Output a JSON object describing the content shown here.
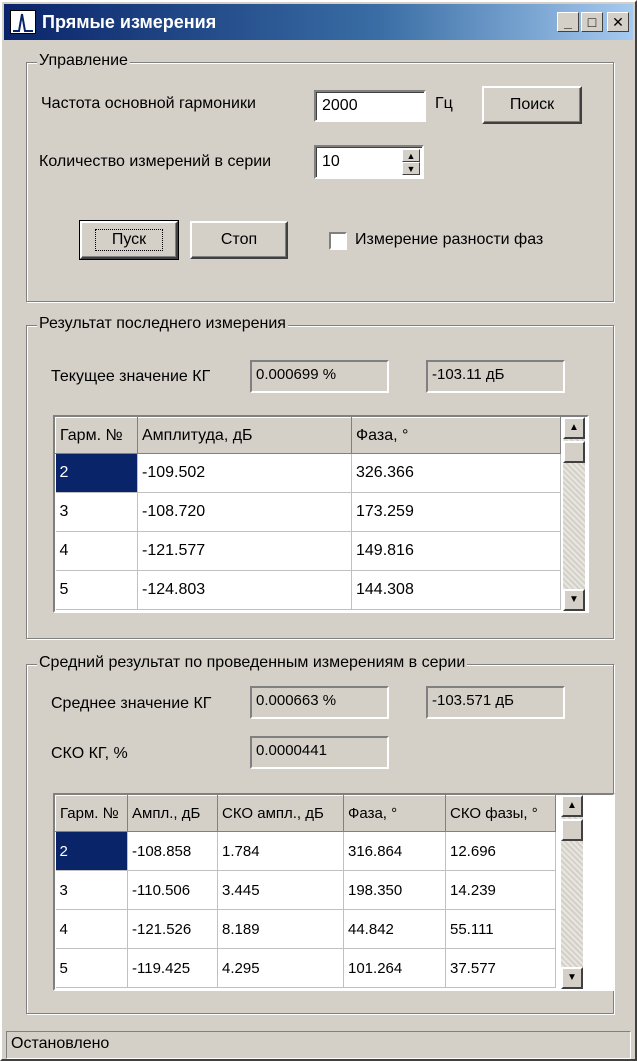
{
  "window": {
    "title": "Прямые измерения",
    "buttons": {
      "minimize": "_",
      "maximize": "□",
      "close": "✕"
    }
  },
  "control": {
    "legend": "Управление",
    "freq_label": "Частота основной гармоники",
    "freq_value": "2000",
    "freq_unit": "Гц",
    "search_label": "Поиск",
    "count_label": "Количество измерений в серии",
    "count_value": "10",
    "start_label": "Пуск",
    "stop_label": "Стоп",
    "phase_diff_label": "Измерение разности фаз"
  },
  "last": {
    "legend": "Результат последнего измерения",
    "kg_label": "Текущее значение КГ",
    "kg_percent": "0.000699 %",
    "kg_db": "-103.11 дБ",
    "columns": [
      "Гарм. №",
      "Амплитуда, дБ",
      "Фаза, °"
    ],
    "rows": [
      [
        "2",
        "-109.502",
        "326.366"
      ],
      [
        "3",
        "-108.720",
        "173.259"
      ],
      [
        "4",
        "-121.577",
        "149.816"
      ],
      [
        "5",
        "-124.803",
        "144.308"
      ]
    ]
  },
  "avg": {
    "legend": "Средний результат по проведенным измерениям в серии",
    "kg_label": "Среднее значение КГ",
    "kg_percent": "0.000663 %",
    "kg_db": "-103.571 дБ",
    "sko_label": "СКО КГ, %",
    "sko_value": "0.0000441",
    "columns": [
      "Гарм. №",
      "Ампл., дБ",
      "СКО ампл., дБ",
      "Фаза, °",
      "СКО фазы, °"
    ],
    "rows": [
      [
        "2",
        "-108.858",
        "1.784",
        "316.864",
        "12.696"
      ],
      [
        "3",
        "-110.506",
        "3.445",
        "198.350",
        "14.239"
      ],
      [
        "4",
        "-121.526",
        "8.189",
        "44.842",
        "55.111"
      ],
      [
        "5",
        "-119.425",
        "4.295",
        "101.264",
        "37.577"
      ]
    ]
  },
  "status": {
    "text": "Остановлено"
  },
  "icons": {
    "up": "▲",
    "down": "▼"
  }
}
